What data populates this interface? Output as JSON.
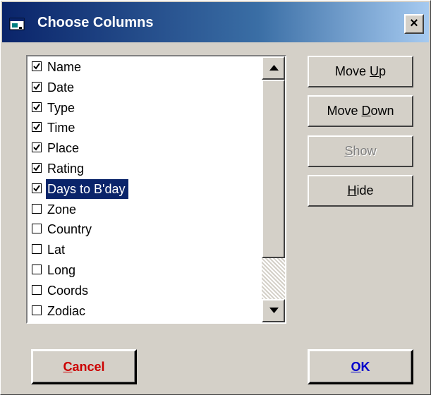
{
  "window": {
    "title": "Choose Columns",
    "close_label": "×",
    "icon": "app-window-icon"
  },
  "columns": [
    {
      "label": "Name",
      "checked": true,
      "selected": false
    },
    {
      "label": "Date",
      "checked": true,
      "selected": false
    },
    {
      "label": "Type",
      "checked": true,
      "selected": false
    },
    {
      "label": "Time",
      "checked": true,
      "selected": false
    },
    {
      "label": "Place",
      "checked": true,
      "selected": false
    },
    {
      "label": "Rating",
      "checked": true,
      "selected": false
    },
    {
      "label": "Days to B'day",
      "checked": true,
      "selected": true
    },
    {
      "label": "Zone",
      "checked": false,
      "selected": false
    },
    {
      "label": "Country",
      "checked": false,
      "selected": false
    },
    {
      "label": "Lat",
      "checked": false,
      "selected": false
    },
    {
      "label": "Long",
      "checked": false,
      "selected": false
    },
    {
      "label": "Coords",
      "checked": false,
      "selected": false
    },
    {
      "label": "Zodiac",
      "checked": false,
      "selected": false
    }
  ],
  "buttons": {
    "move_up": {
      "pre": "Move ",
      "key": "U",
      "post": "p"
    },
    "move_down": {
      "pre": "Move ",
      "key": "D",
      "post": "own"
    },
    "show": {
      "pre": "",
      "key": "S",
      "post": "how",
      "disabled": true
    },
    "hide": {
      "pre": "",
      "key": "H",
      "post": "ide"
    },
    "cancel": {
      "pre": "",
      "key": "C",
      "post": "ancel"
    },
    "ok": {
      "pre": "",
      "key": "O",
      "post": "K"
    }
  },
  "colors": {
    "title_start": "#0a246a",
    "selection": "#0a246a",
    "cancel_text": "#cc0000",
    "ok_text": "#0000cc"
  }
}
